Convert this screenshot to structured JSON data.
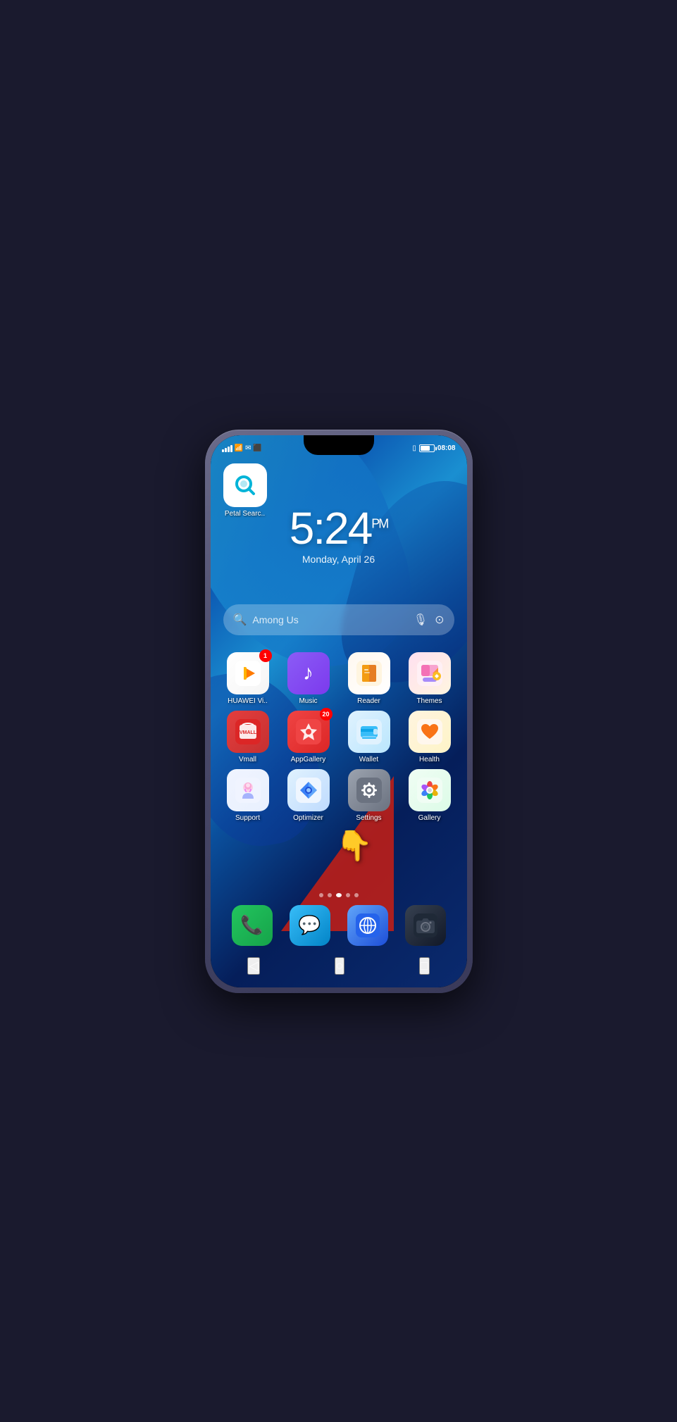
{
  "statusBar": {
    "time": "08:08",
    "battery": "70"
  },
  "clock": {
    "time": "5:24",
    "ampm": "PM",
    "date": "Monday, April 26"
  },
  "search": {
    "placeholder": "Among Us",
    "micLabel": "mic",
    "scanLabel": "scan"
  },
  "topApp": {
    "name": "Petal Searc..",
    "icon": "petal-search"
  },
  "appRows": [
    [
      {
        "id": "huawei-video",
        "name": "HUAWEI Vi..",
        "badge": "1",
        "iconClass": "icon-video",
        "iconType": "video"
      },
      {
        "id": "music",
        "name": "Music",
        "badge": null,
        "iconClass": "icon-music",
        "iconType": "music"
      },
      {
        "id": "reader",
        "name": "Reader",
        "badge": null,
        "iconClass": "icon-reader",
        "iconType": "reader"
      },
      {
        "id": "themes",
        "name": "Themes",
        "badge": null,
        "iconClass": "icon-themes",
        "iconType": "themes"
      }
    ],
    [
      {
        "id": "vmall",
        "name": "Vmall",
        "badge": null,
        "iconClass": "icon-vmall",
        "iconType": "vmall"
      },
      {
        "id": "appgallery",
        "name": "AppGallery",
        "badge": "20",
        "iconClass": "icon-appgallery",
        "iconType": "appgallery"
      },
      {
        "id": "wallet",
        "name": "Wallet",
        "badge": null,
        "iconClass": "icon-wallet",
        "iconType": "wallet"
      },
      {
        "id": "health",
        "name": "Health",
        "badge": null,
        "iconClass": "icon-health",
        "iconType": "health"
      }
    ],
    [
      {
        "id": "support",
        "name": "Support",
        "badge": null,
        "iconClass": "icon-support",
        "iconType": "support"
      },
      {
        "id": "optimizer",
        "name": "Optimizer",
        "badge": null,
        "iconClass": "icon-optimizer",
        "iconType": "optimizer"
      },
      {
        "id": "settings",
        "name": "Settings",
        "badge": null,
        "iconClass": "icon-settings",
        "iconType": "settings"
      },
      {
        "id": "gallery",
        "name": "Gallery",
        "badge": null,
        "iconClass": "icon-gallery",
        "iconType": "gallery"
      }
    ]
  ],
  "pageDots": [
    false,
    false,
    true,
    false,
    false
  ],
  "dock": [
    {
      "id": "phone",
      "iconType": "phone"
    },
    {
      "id": "messages",
      "iconType": "messages"
    },
    {
      "id": "browser",
      "iconType": "browser"
    },
    {
      "id": "camera",
      "iconType": "camera"
    }
  ],
  "navBar": {
    "back": "◁",
    "home": "○",
    "recent": "□"
  }
}
